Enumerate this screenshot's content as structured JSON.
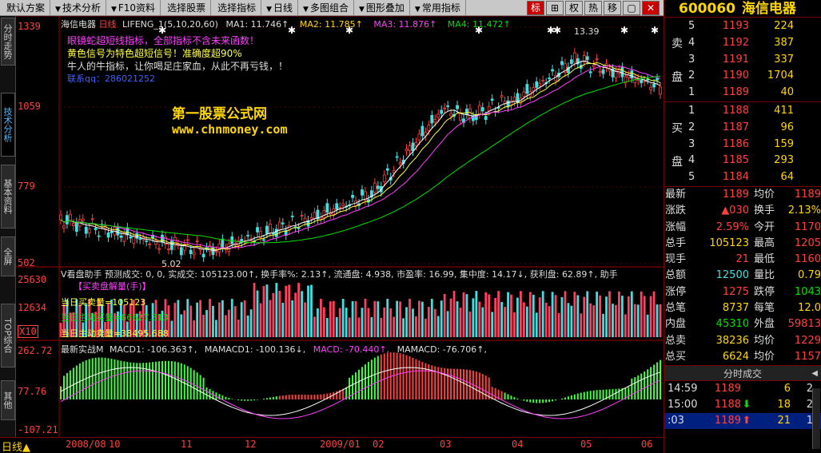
{
  "menubar": {
    "items": [
      {
        "label": "默认方案",
        "arrow": ""
      },
      {
        "label": "技术分析",
        "arrow": "▼"
      },
      {
        "label": "F10资料",
        "arrow": "▼"
      },
      {
        "label": "选择股票",
        "arrow": ""
      },
      {
        "label": "选择指标",
        "arrow": ""
      },
      {
        "label": "日线",
        "arrow": "▼"
      },
      {
        "label": "多图组合",
        "arrow": "▼"
      },
      {
        "label": "图形叠加",
        "arrow": "▼"
      },
      {
        "label": "常用指标",
        "arrow": "▼"
      }
    ],
    "tools": [
      "标",
      "⊞",
      "权",
      "热",
      "移",
      "▢",
      "✕"
    ]
  },
  "sidebar": {
    "tabs": [
      "分时走势",
      "技术分析",
      "基本资料",
      "全屏",
      "TOP综合",
      "其他"
    ]
  },
  "chart": {
    "main_header": {
      "name": "海信电器",
      "period": "日线",
      "indicator": "LIFENG_1",
      "params": "(5,10,20,60)",
      "ma1": "MA1: 11.746↑",
      "ma2": "MA2: 11.785↑",
      "ma3": "MA3: 11.876↑",
      "ma4": "MA4: 11.472↑"
    },
    "notes": [
      "眼镜蛇超短线指标，全部指标不含未来函数！",
      "黄色信号为特色超短信号！准确度超90%",
      "牛人的牛指标，让你喝足庄家血，从此不再亏钱，！",
      "联系qq：286021252"
    ],
    "watermark": {
      "title": "第一股票公式网",
      "url": "www.chnmoney.com"
    },
    "price_axis": [
      "1339",
      "1059",
      "779",
      "502"
    ],
    "high_label": "13.39",
    "low_label": "5.02",
    "volume_header": "V看盘助手 预测成交: 0, 0, 实成交: 105123.00↑, 换手率%: 2.13↑, 流通盘: 4.938, 市盈率: 16.99, 集中度: 14.17↓, 获利盘: 62.89↑, 助手",
    "volume_sub": "【买卖盘解量(手)】",
    "volume_lines": [
      "当日买卖量=105123",
      "当日主动买量=66627.313",
      "当日主动卖量=38495.688"
    ],
    "volume_axis": [
      "25630",
      "12634",
      "X10"
    ],
    "macd_header": {
      "name": "最新实战M",
      "macd1": "MACD1: -106.363↑,",
      "mamacd1": "MAMACD1: -100.136↓,",
      "macd": "MACD: -70.440↑,",
      "mamacd": "MAMACD: -76.706↑,"
    },
    "macd_axis": [
      "262.72",
      "77.76",
      "-107.21"
    ]
  },
  "bottombar": {
    "period": "日线",
    "dates": [
      "2008/08",
      "10",
      "11",
      "12",
      "2009/01",
      "02",
      "03",
      "04",
      "05",
      "06"
    ]
  },
  "quote": {
    "code": "600060",
    "name": "海信电器",
    "sell_label": [
      "卖",
      "盘"
    ],
    "buy_label": [
      "买",
      "盘"
    ],
    "sell": [
      {
        "lvl": "5",
        "px": "1193",
        "vol": "224"
      },
      {
        "lvl": "4",
        "px": "1192",
        "vol": "387"
      },
      {
        "lvl": "3",
        "px": "1191",
        "vol": "337"
      },
      {
        "lvl": "2",
        "px": "1190",
        "vol": "1704"
      },
      {
        "lvl": "1",
        "px": "1189",
        "vol": "40"
      }
    ],
    "buy": [
      {
        "lvl": "1",
        "px": "1188",
        "vol": "411"
      },
      {
        "lvl": "2",
        "px": "1187",
        "vol": "96"
      },
      {
        "lvl": "3",
        "px": "1186",
        "vol": "159"
      },
      {
        "lvl": "4",
        "px": "1185",
        "vol": "293"
      },
      {
        "lvl": "5",
        "px": "1184",
        "vol": "64"
      }
    ],
    "stats": [
      {
        "k1": "最新",
        "v1": "1189",
        "c1": "red",
        "k2": "均价",
        "v2": "1189",
        "c2": "red"
      },
      {
        "k1": "涨跌",
        "v1": "▲030",
        "c1": "red",
        "k2": "换手",
        "v2": "2.13%",
        "c2": "yel"
      },
      {
        "k1": "涨幅",
        "v1": "2.59%",
        "c1": "red",
        "k2": "今开",
        "v2": "1170",
        "c2": "red"
      },
      {
        "k1": "总手",
        "v1": "105123",
        "c1": "yel",
        "k2": "最高",
        "v2": "1205",
        "c2": "red"
      },
      {
        "k1": "现手",
        "v1": "21",
        "c1": "red",
        "k2": "最低",
        "v2": "1160",
        "c2": "red"
      },
      {
        "k1": "总额",
        "v1": "12500",
        "c1": "cyn",
        "k2": "量比",
        "v2": "0.79",
        "c2": "yel"
      },
      {
        "k1": "涨停",
        "v1": "1275",
        "c1": "red",
        "k2": "跌停",
        "v2": "1043",
        "c2": "grn"
      },
      {
        "k1": "总笔",
        "v1": "8737",
        "c1": "yel",
        "k2": "每笔",
        "v2": "12.0",
        "c2": "yel"
      },
      {
        "k1": "内盘",
        "v1": "45310",
        "c1": "grn",
        "k2": "外盘",
        "v2": "59813",
        "c2": "red"
      },
      {
        "k1": "总卖",
        "v1": "38236",
        "c1": "yel",
        "k2": "均价",
        "v2": "1229",
        "c2": "red"
      },
      {
        "k1": "总买",
        "v1": "6624",
        "c1": "yel",
        "k2": "均价",
        "v2": "1157",
        "c2": "red"
      }
    ],
    "ticks_title": "分时成交",
    "ticks": [
      {
        "t": "14:59",
        "p": "1189",
        "a": "",
        "v": "6",
        "n": "2",
        "ac": "red"
      },
      {
        "t": "15:00",
        "p": "1188",
        "a": "⬇",
        "v": "18",
        "n": "2",
        "ac": "grn"
      },
      {
        "t": ":03",
        "p": "1189",
        "a": "⬆",
        "v": "21",
        "n": "1",
        "ac": "red"
      }
    ]
  }
}
